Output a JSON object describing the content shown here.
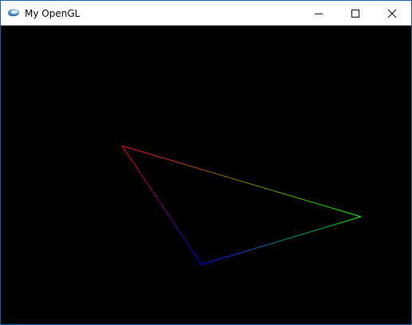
{
  "window": {
    "title": "My OpenGL",
    "controls": {
      "minimize_icon": "minimize-icon",
      "maximize_icon": "maximize-icon",
      "close_icon": "close-icon"
    },
    "title_icon": "opengl-app-icon"
  },
  "scene": {
    "background": "#000000",
    "triangle": {
      "vertex_colors": [
        "#ff0000",
        "#00ff00",
        "#0000ff"
      ]
    }
  }
}
